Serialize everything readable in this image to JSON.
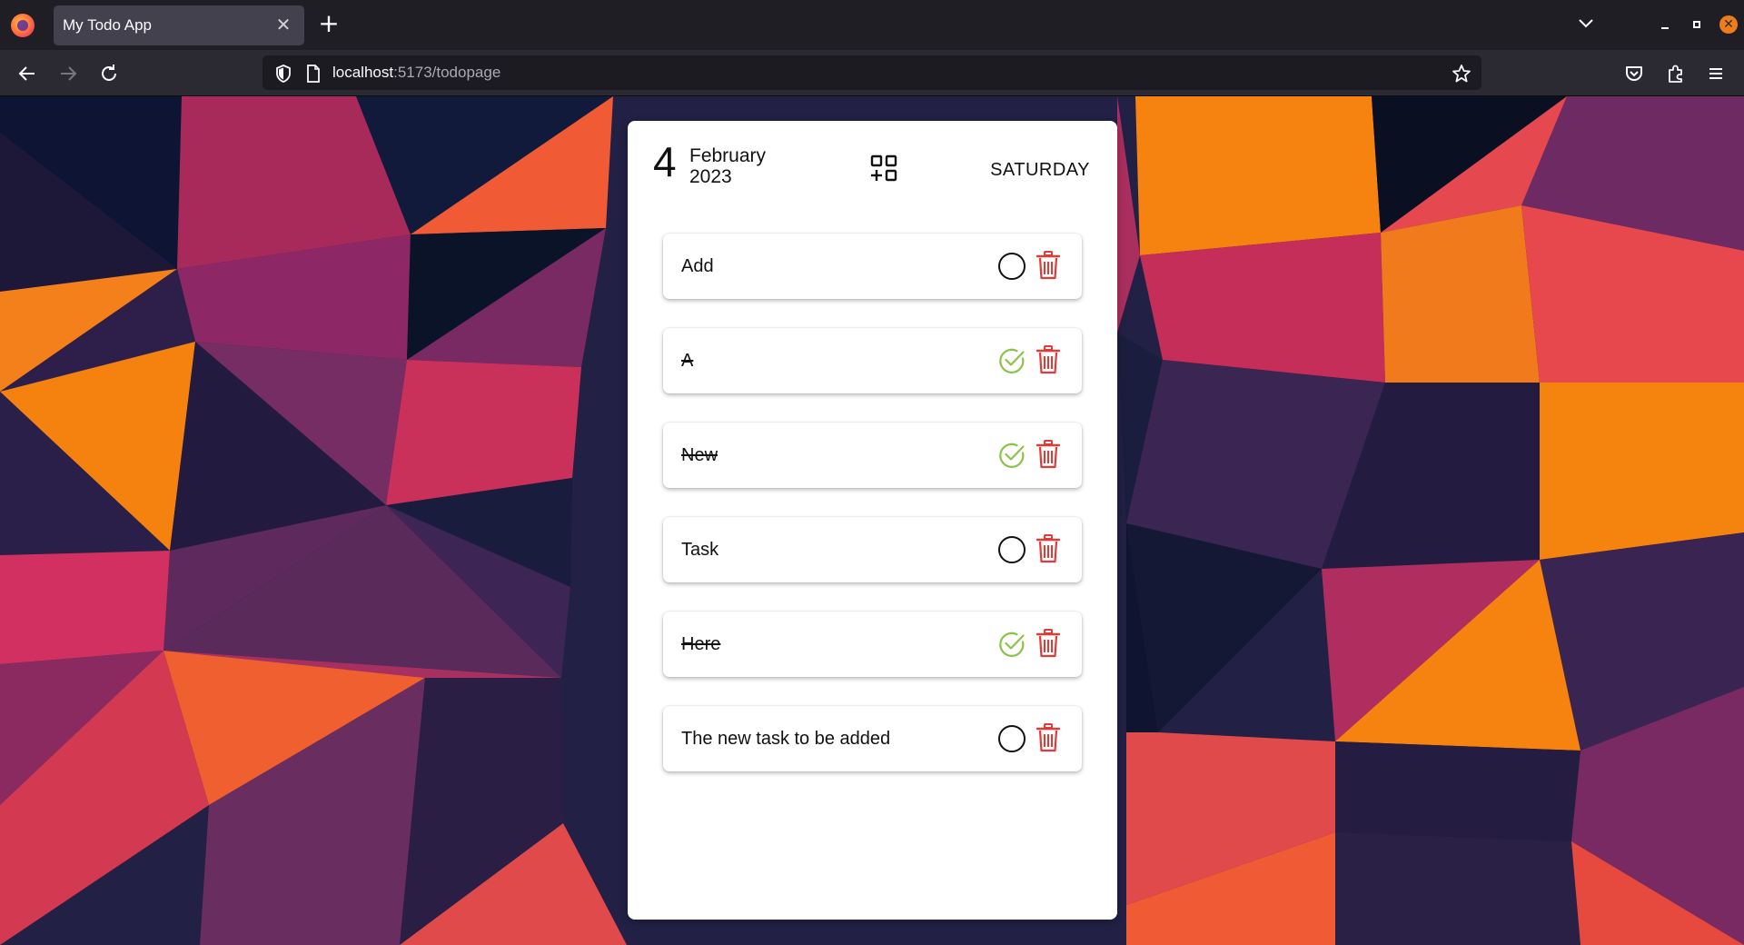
{
  "browser": {
    "tab_title": "My Todo App",
    "url_host": "localhost",
    "url_rest": ":5173/todopage"
  },
  "header": {
    "day": "4",
    "month": "February",
    "year": "2023",
    "weekday": "SATURDAY"
  },
  "todos": [
    {
      "text": "Add",
      "done": false
    },
    {
      "text": "A",
      "done": true
    },
    {
      "text": "New",
      "done": true
    },
    {
      "text": "Task",
      "done": false
    },
    {
      "text": "Here",
      "done": true
    },
    {
      "text": "The new task to be added",
      "done": false
    }
  ],
  "colors": {
    "check_green": "#8bc34a",
    "trash_red": "#e53935",
    "card_bg": "#ffffff"
  }
}
